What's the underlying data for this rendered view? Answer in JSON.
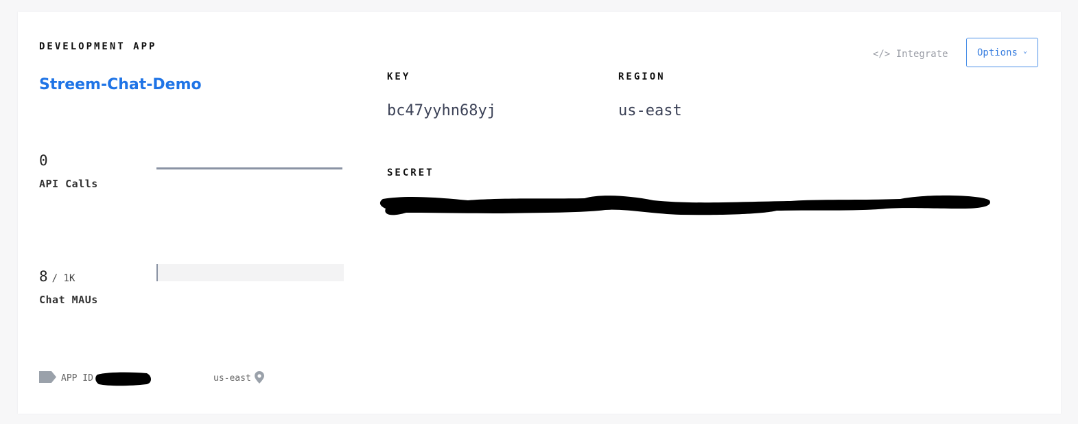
{
  "app": {
    "environment_label": "DEVELOPMENT APP",
    "name": "Streem-Chat-Demo"
  },
  "stats": {
    "api_calls": {
      "value": "0",
      "label": "API Calls"
    },
    "chat_maus": {
      "value": "8",
      "max": "/ 1K",
      "label": "Chat MAUs",
      "usage_fraction": 0.008
    }
  },
  "details": {
    "key_label": "KEY",
    "key_value": "bc47yyhn68yj",
    "region_label": "REGION",
    "region_value": "us-east",
    "secret_label": "SECRET"
  },
  "actions": {
    "integrate_label": "</> Integrate",
    "options_label": "Options"
  },
  "footer": {
    "app_id_label": "APP ID",
    "region": "us-east"
  },
  "colors": {
    "accent": "#1f74e6",
    "bar": "#8a93a4",
    "redaction": "#000000"
  },
  "icons": {
    "tag": "tag-icon",
    "pin": "map-pin-icon",
    "chevron": "chevron-down-icon"
  }
}
